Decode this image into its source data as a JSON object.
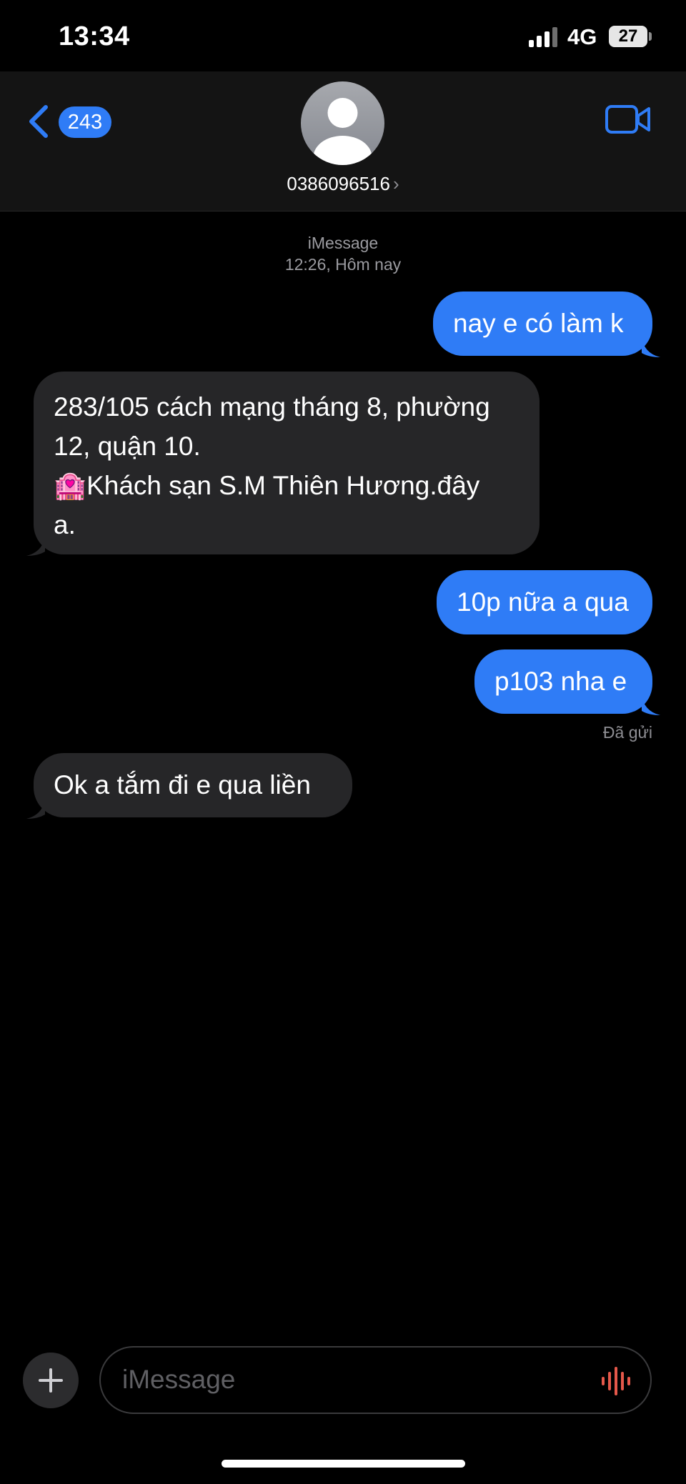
{
  "status_bar": {
    "time": "13:34",
    "network": "4G",
    "battery": "27"
  },
  "header": {
    "back_count": "243",
    "contact": "0386096516"
  },
  "thread": {
    "service": "iMessage",
    "timestamp": "12:26, Hôm nay"
  },
  "messages": [
    {
      "direction": "sent",
      "text": "nay e có làm k"
    },
    {
      "direction": "received",
      "lines": [
        "283/105 cách mạng tháng 8, phường",
        "12, quận 10.",
        "Khách sạn S.M Thiên Hương.đây",
        "a."
      ],
      "emoji": "🏩"
    },
    {
      "direction": "sent",
      "text": "10p nữa a qua"
    },
    {
      "direction": "sent",
      "text": "p103 nha e"
    },
    {
      "direction": "received",
      "text": "Ok a tắm đi e qua liền"
    }
  ],
  "delivery_status": "Đã gửi",
  "input": {
    "placeholder": "iMessage"
  },
  "icons": {
    "back": "chevron-left-icon",
    "video": "video-camera-icon",
    "plus": "plus-icon",
    "audio": "waveform-icon",
    "avatar": "person-icon"
  },
  "colors": {
    "sent_bubble": "#2f7cf6",
    "received_bubble": "#262628",
    "accent": "#2f7cf6",
    "waveform": "#e5584a"
  }
}
